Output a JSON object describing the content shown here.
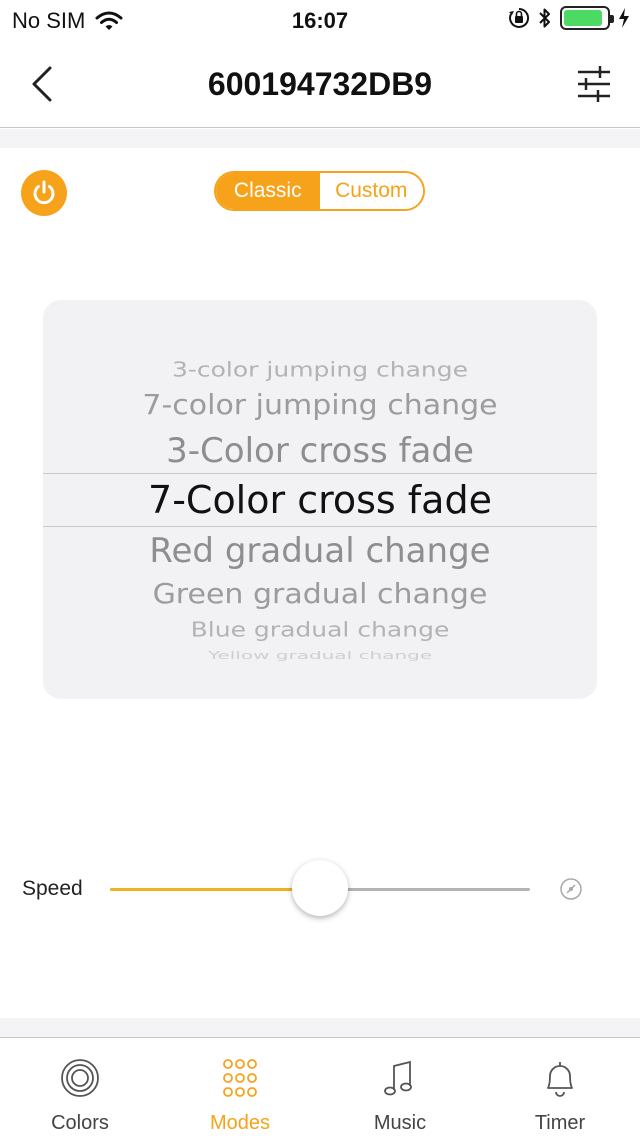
{
  "status_bar": {
    "carrier": "No SIM",
    "time": "16:07",
    "icons": [
      "wifi-icon",
      "orientation-lock-icon",
      "bluetooth-icon",
      "battery-icon",
      "charging-icon"
    ],
    "battery_level": 0.9
  },
  "nav": {
    "title": "600194732DB9",
    "back_icon": "chevron-left-icon",
    "settings_icon": "sliders-icon"
  },
  "mode_switch": {
    "options": [
      "Classic",
      "Custom"
    ],
    "selected": "Classic"
  },
  "picker": {
    "items": [
      "3-color jumping change",
      "7-color jumping change",
      "3-Color cross fade",
      "7-Color cross fade",
      "Red gradual change",
      "Green gradual change",
      "Blue gradual change",
      "Yellow gradual change"
    ],
    "selected_index": 3
  },
  "speed": {
    "label": "Speed",
    "value": 0.5
  },
  "tabs": [
    {
      "label": "Colors",
      "icon": "colors-icon",
      "active": false
    },
    {
      "label": "Modes",
      "icon": "modes-icon",
      "active": true
    },
    {
      "label": "Music",
      "icon": "music-icon",
      "active": false
    },
    {
      "label": "Timer",
      "icon": "timer-icon",
      "active": false
    }
  ],
  "colors": {
    "accent": "#f7a21b",
    "slider": "#f0b021",
    "picker_bg": "#f2f2f4"
  }
}
